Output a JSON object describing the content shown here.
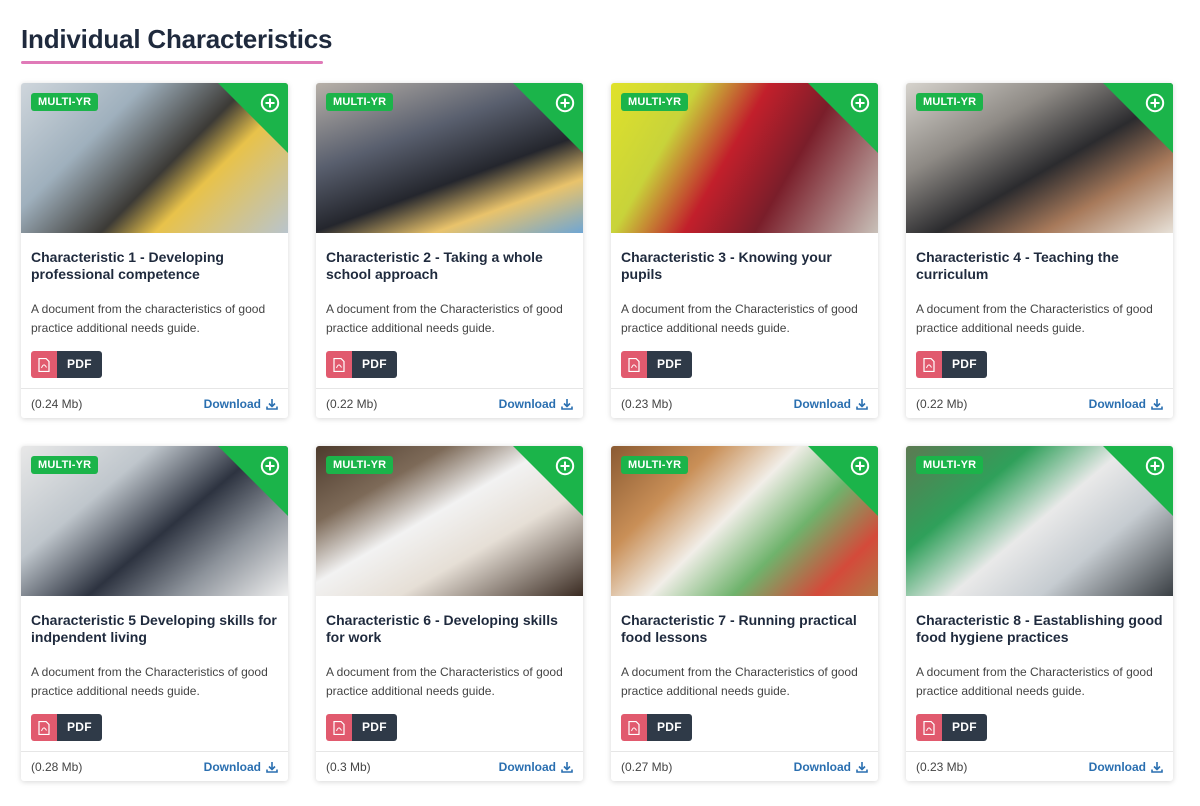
{
  "page": {
    "title": "Individual Characteristics"
  },
  "common": {
    "badge": "MULTI-YR",
    "file_type": "PDF",
    "download_label": "Download",
    "corner_icon": "plus-circle-icon",
    "file_icon": "pdf-file-icon",
    "download_icon": "download-icon",
    "accent_green": "#1bb44a",
    "pdf_red": "#e15a6e",
    "link_blue": "#2a6fb0"
  },
  "cards": [
    {
      "title": "Characteristic 1 - Developing professional competence",
      "description": "A document from the characteristics of good practice additional needs guide.",
      "size": "(0.24 Mb)"
    },
    {
      "title": "Characteristic 2 - Taking a whole school approach",
      "description": "A document from the Characteristics of good practice additional needs guide.",
      "size": "(0.22 Mb)"
    },
    {
      "title": "Characteristic 3 - Knowing your pupils",
      "description": "A document from the Characteristics of good practice additional needs guide.",
      "size": "(0.23 Mb)"
    },
    {
      "title": "Characteristic 4 - Teaching the curriculum",
      "description": "A document from the Characteristics of good practice additional needs guide.",
      "size": "(0.22 Mb)"
    },
    {
      "title": "Characteristic 5 Developing skills for indpendent living",
      "description": "A document from the Characteristics of good practice additional needs guide.",
      "size": "(0.28 Mb)"
    },
    {
      "title": "Characteristic 6 - Developing skills for work",
      "description": "A document from the Characteristics of good practice additional needs guide.",
      "size": "(0.3 Mb)"
    },
    {
      "title": "Characteristic 7 - Running practical food lessons",
      "description": "A document from the Characteristics of good practice additional needs guide.",
      "size": "(0.27 Mb)"
    },
    {
      "title": "Characteristic 8 - Eastablishing good food hygiene practices",
      "description": "A document from the Characteristics of good practice additional needs guide.",
      "size": "(0.23 Mb)"
    }
  ]
}
